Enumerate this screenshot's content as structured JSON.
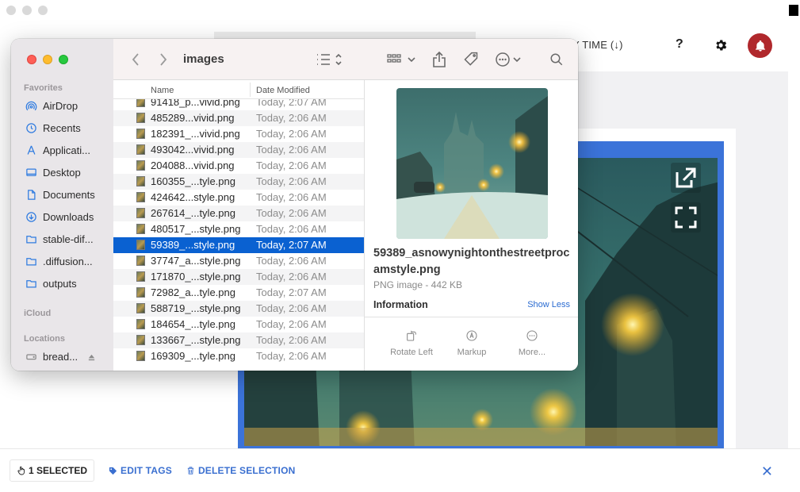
{
  "background_app": {
    "sort_label": "Y TIME (↓)",
    "help_label": "?",
    "accent_color": "#3b73d9",
    "bell_color": "#b0282c"
  },
  "bottom_bar": {
    "selected_label": "1 SELECTED",
    "edit_tags_label": "EDIT TAGS",
    "delete_label": "DELETE SELECTION",
    "close_label": "✕"
  },
  "finder": {
    "folder_title": "images",
    "sidebar": {
      "favorites_heading": "Favorites",
      "favorites": [
        {
          "label": "AirDrop",
          "icon": "airdrop-icon"
        },
        {
          "label": "Recents",
          "icon": "clock-icon"
        },
        {
          "label": "Applicati...",
          "icon": "applications-icon"
        },
        {
          "label": "Desktop",
          "icon": "desktop-icon"
        },
        {
          "label": "Documents",
          "icon": "document-icon"
        },
        {
          "label": "Downloads",
          "icon": "download-icon"
        },
        {
          "label": "stable-dif...",
          "icon": "folder-icon"
        },
        {
          "label": ".diffusion...",
          "icon": "folder-icon"
        },
        {
          "label": "outputs",
          "icon": "folder-icon"
        }
      ],
      "icloud_heading": "iCloud",
      "locations_heading": "Locations",
      "locations": [
        {
          "label": "bread...",
          "icon": "drive-icon"
        }
      ]
    },
    "columns": {
      "name": "Name",
      "date": "Date Modified"
    },
    "files": [
      {
        "name": "91418_p...vivid.png",
        "date": "Today, 2:07 AM"
      },
      {
        "name": "485289...vivid.png",
        "date": "Today, 2:06 AM"
      },
      {
        "name": "182391_...vivid.png",
        "date": "Today, 2:06 AM"
      },
      {
        "name": "493042...vivid.png",
        "date": "Today, 2:06 AM"
      },
      {
        "name": "204088...vivid.png",
        "date": "Today, 2:06 AM"
      },
      {
        "name": "160355_...tyle.png",
        "date": "Today, 2:06 AM"
      },
      {
        "name": "424642...style.png",
        "date": "Today, 2:06 AM"
      },
      {
        "name": "267614_...tyle.png",
        "date": "Today, 2:06 AM"
      },
      {
        "name": "480517_...style.png",
        "date": "Today, 2:06 AM"
      },
      {
        "name": "59389_...style.png",
        "date": "Today, 2:07 AM",
        "selected": true
      },
      {
        "name": "37747_a...style.png",
        "date": "Today, 2:06 AM"
      },
      {
        "name": "171870_...style.png",
        "date": "Today, 2:06 AM"
      },
      {
        "name": "72982_a...tyle.png",
        "date": "Today, 2:07 AM"
      },
      {
        "name": "588719_...style.png",
        "date": "Today, 2:06 AM"
      },
      {
        "name": "184654_...tyle.png",
        "date": "Today, 2:06 AM"
      },
      {
        "name": "133667_...style.png",
        "date": "Today, 2:06 AM"
      },
      {
        "name": "169309_...tyle.png",
        "date": "Today, 2:06 AM"
      }
    ],
    "preview": {
      "filename": "59389_asnowynightonthestreetprocamstyle.png",
      "kind": "PNG image - 442 KB",
      "info_heading": "Information",
      "show_less": "Show Less",
      "actions": [
        {
          "label": "Rotate Left",
          "icon": "rotate-left-icon"
        },
        {
          "label": "Markup",
          "icon": "markup-icon"
        },
        {
          "label": "More...",
          "icon": "more-icon"
        }
      ]
    }
  }
}
